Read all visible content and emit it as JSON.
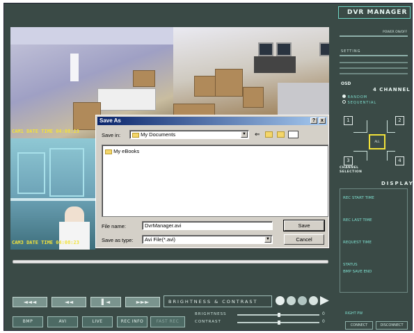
{
  "app": {
    "title": "DVR MANAGER",
    "power_label": "POWER ON/OFF",
    "setting_label": "SETTING",
    "osd_label": "OSD",
    "channel_title": "4 CHANNEL",
    "radio_random": "RANDOM",
    "radio_sequential": "SEQUENTIAL",
    "channel_selection": "CHANNEL\nSELECTION",
    "channels": [
      "1",
      "2",
      "3",
      "4"
    ],
    "center_channel": "ALL",
    "display_title": "DISPLAY",
    "rec_start_time": "REC START TIME",
    "rec_last_time": "REC LAST TIME",
    "request_time": "REQUEST TIME",
    "status": "STATUS",
    "status_value": "BMP SAVE END",
    "right_pw": "RIGHT PW",
    "connect": "CONNECT",
    "disconnect": "DISCONNECT"
  },
  "cameras": {
    "cam1_label": "CAM1 DATE TIME  04:08:23",
    "cam3_label": "CAM3 DATE TIME  04:08:23"
  },
  "transport": {
    "buttons": [
      "◄◄◄",
      "◄◄",
      "▌◄",
      "►►►"
    ]
  },
  "brightness": {
    "title": "BRIGHTNESS & CONTRAST",
    "brightness_label": "BRIGHTNESS",
    "contrast_label": "CONTRAST",
    "brightness_value": "0",
    "contrast_value": "0"
  },
  "actions": [
    "BMP",
    "AVI",
    "LIVE",
    "REC INFO",
    "FAST REC"
  ],
  "dialog": {
    "title": "Save As",
    "help": "?",
    "close": "x",
    "save_in_label": "Save in:",
    "save_in_value": "My Documents",
    "folder_item": "My eBooks",
    "file_name_label": "File name:",
    "file_name_value": "DvrManager.avi",
    "save_as_type_label": "Save as type:",
    "save_as_type_value": "Avi File(*.avi)",
    "save_button": "Save",
    "cancel_button": "Cancel"
  }
}
